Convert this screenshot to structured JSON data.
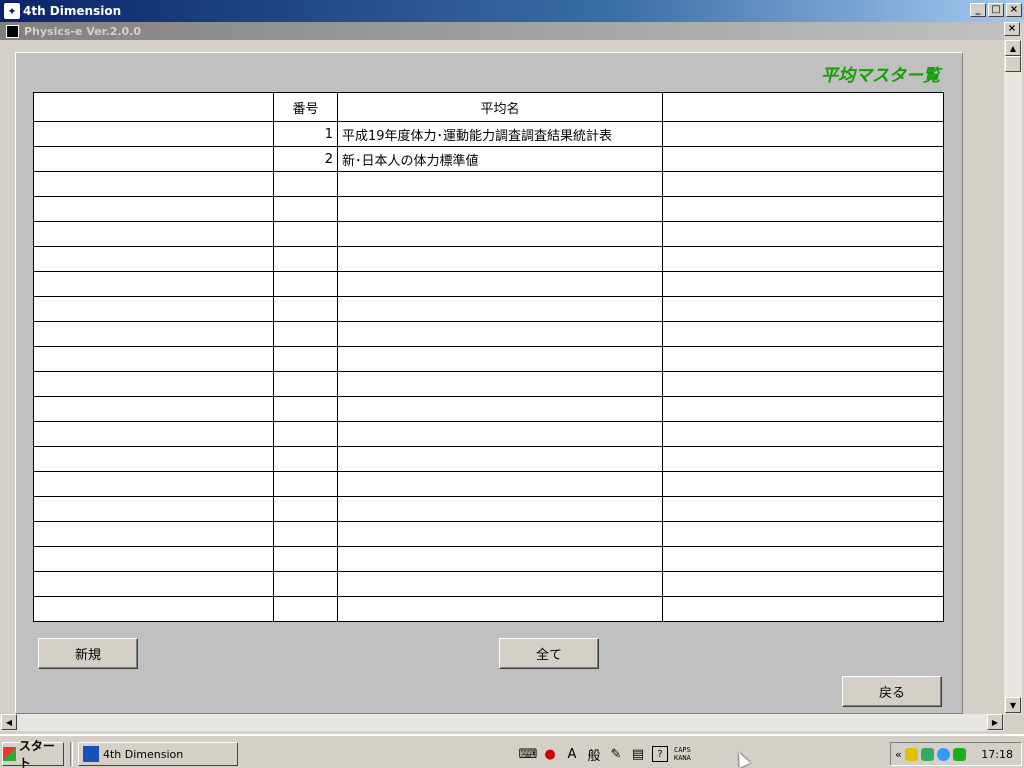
{
  "app_title": "4th Dimension",
  "doc_title": "Physics-e  Ver.2.0.0",
  "window_buttons": {
    "minimize": "_",
    "maximize": "□",
    "close": "×"
  },
  "heading": "平均マスター覧",
  "table": {
    "headers": [
      "",
      "番号",
      "平均名",
      ""
    ],
    "rows": [
      [
        "",
        "1",
        "平成19年度体力･運動能力調査調査結果統計表",
        ""
      ],
      [
        "",
        "2",
        "新･日本人の体力標準値",
        ""
      ],
      [
        "",
        "",
        "",
        ""
      ],
      [
        "",
        "",
        "",
        ""
      ],
      [
        "",
        "",
        "",
        ""
      ],
      [
        "",
        "",
        "",
        ""
      ],
      [
        "",
        "",
        "",
        ""
      ],
      [
        "",
        "",
        "",
        ""
      ],
      [
        "",
        "",
        "",
        ""
      ],
      [
        "",
        "",
        "",
        ""
      ],
      [
        "",
        "",
        "",
        ""
      ],
      [
        "",
        "",
        "",
        ""
      ],
      [
        "",
        "",
        "",
        ""
      ],
      [
        "",
        "",
        "",
        ""
      ],
      [
        "",
        "",
        "",
        ""
      ],
      [
        "",
        "",
        "",
        ""
      ],
      [
        "",
        "",
        "",
        ""
      ],
      [
        "",
        "",
        "",
        ""
      ],
      [
        "",
        "",
        "",
        ""
      ],
      [
        "",
        "",
        "",
        ""
      ]
    ]
  },
  "buttons": {
    "new": "新規",
    "all": "全て",
    "back": "戻る"
  },
  "taskbar": {
    "start": "スタート",
    "task_item": "4th Dimension",
    "ime": {
      "a": "A",
      "han": "般",
      "caps": "CAPS",
      "kana": "KANA"
    },
    "clock": "17:18",
    "tray_arrow": "«"
  },
  "colors": {
    "heading": "#11a000",
    "title_bar": "#0a246a",
    "panel": "#c0c0c0"
  }
}
